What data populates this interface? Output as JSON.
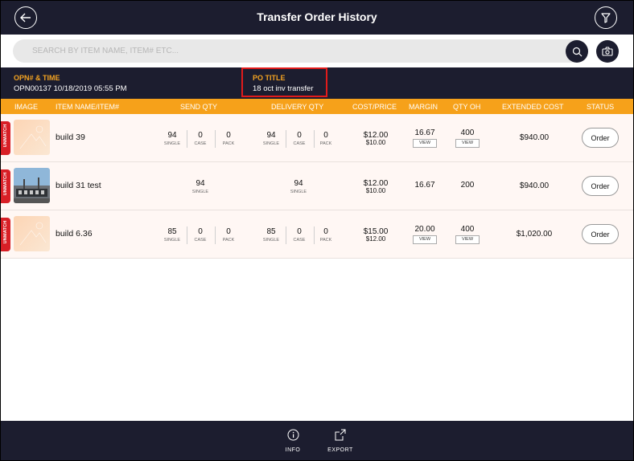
{
  "header": {
    "title": "Transfer Order History"
  },
  "search": {
    "placeholder": "SEARCH BY ITEM NAME, ITEM# ETC..."
  },
  "info": {
    "opn_label": "OPN# & TIME",
    "opn_value": "OPN00137  10/18/2019 05:55 PM",
    "po_label": "PO TITLE",
    "po_value": "18 oct inv transfer"
  },
  "columns": [
    "IMAGE",
    "ITEM NAME/ITEM#",
    "SEND QTY",
    "DELIVERY QTY",
    "COST/PRICE",
    "MARGIN",
    "QTY OH",
    "EXTENDED COST",
    "STATUS"
  ],
  "unmatch_label": "UNMATCH",
  "units": {
    "single": "SINGLE",
    "case": "CASE",
    "pack": "PACK"
  },
  "view_label": "VIEW",
  "order_label": "Order",
  "rows": [
    {
      "name": "build 39",
      "send": {
        "single": "94",
        "case": "0",
        "pack": "0"
      },
      "delivery": {
        "single": "94",
        "case": "0",
        "pack": "0"
      },
      "cost": "$12.00",
      "price": "$10.00",
      "margin": "16.67",
      "qty_oh": "400",
      "extended": "$940.00"
    },
    {
      "name": "build 31 test",
      "send": {
        "single": "94"
      },
      "delivery": {
        "single": "94"
      },
      "cost": "$12.00",
      "price": "$10.00",
      "margin": "16.67",
      "qty_oh": "200",
      "extended": "$940.00"
    },
    {
      "name": "build 6.36",
      "send": {
        "single": "85",
        "case": "0",
        "pack": "0"
      },
      "delivery": {
        "single": "85",
        "case": "0",
        "pack": "0"
      },
      "cost": "$15.00",
      "price": "$12.00",
      "margin": "20.00",
      "qty_oh": "400",
      "extended": "$1,020.00"
    }
  ],
  "footer": {
    "info_label": "INFO",
    "export_label": "EXPORT"
  }
}
